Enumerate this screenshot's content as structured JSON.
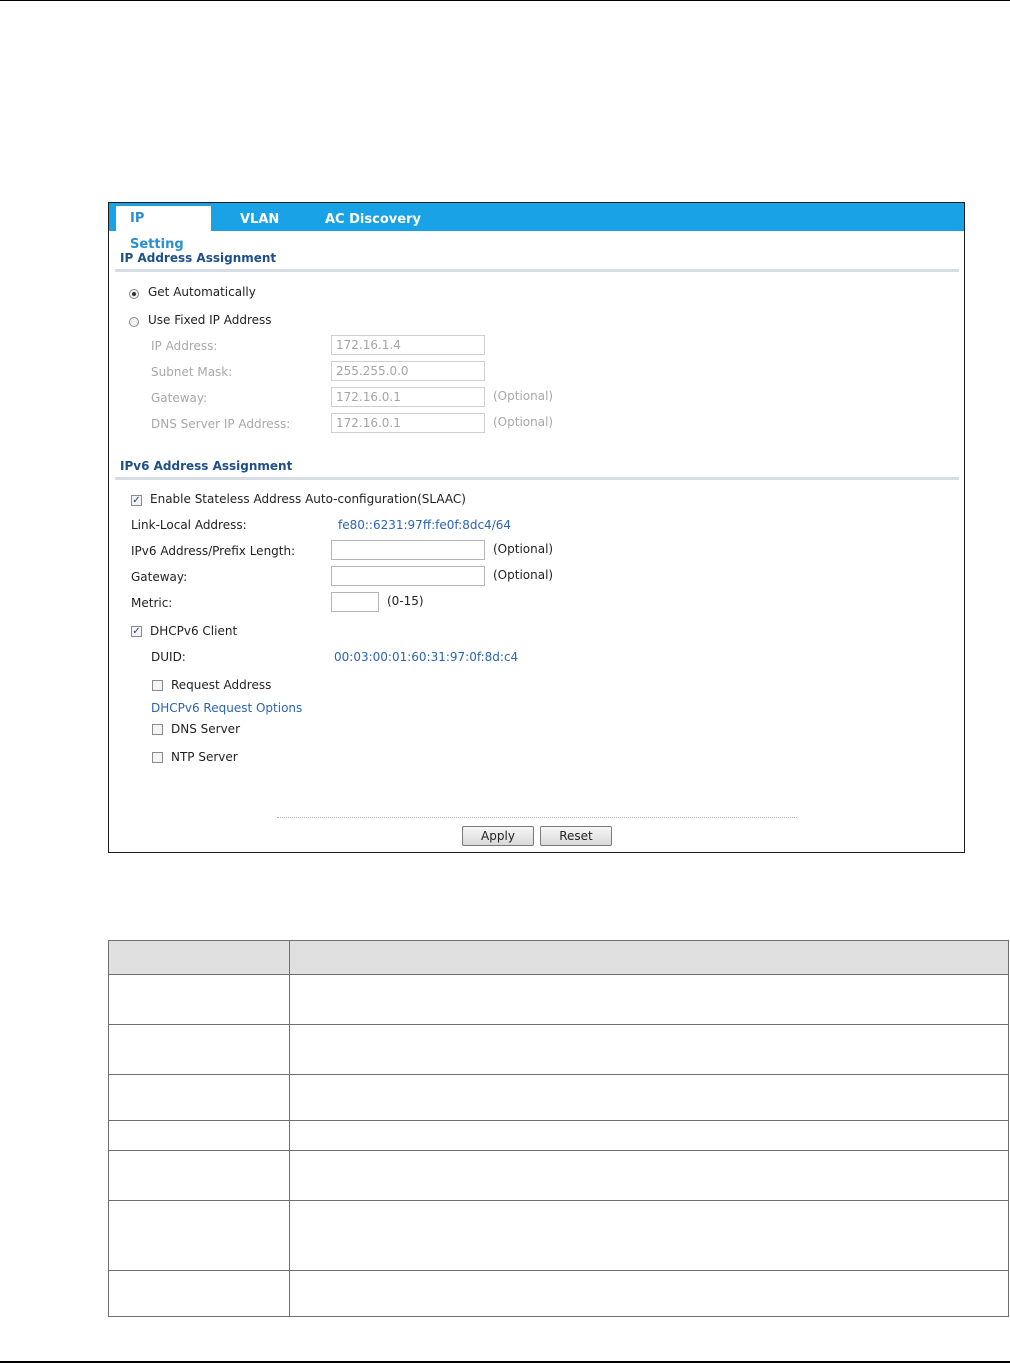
{
  "tabs": [
    {
      "label": "IP Setting",
      "active": true
    },
    {
      "label": "VLAN",
      "active": false
    },
    {
      "label": "AC Discovery",
      "active": false
    }
  ],
  "ipv4": {
    "title": "IP Address Assignment",
    "get_auto_label": "Get Automatically",
    "use_fixed_label": "Use Fixed IP Address",
    "mode": "Get Automatically",
    "ip_label": "IP Address:",
    "ip_value": "172.16.1.4",
    "mask_label": "Subnet Mask:",
    "mask_value": "255.255.0.0",
    "gateway_label": "Gateway:",
    "gateway_value": "172.16.0.1",
    "gateway_optional": "(Optional)",
    "dns_label": "DNS Server IP Address:",
    "dns_value": "172.16.0.1",
    "dns_optional": "(Optional)"
  },
  "ipv6": {
    "title": "IPv6 Address Assignment",
    "slaac_label": "Enable Stateless Address Auto-configuration(SLAAC)",
    "slaac_checked": true,
    "link_local_label": "Link-Local Address:",
    "link_local_value": "fe80::6231:97ff:fe0f:8dc4/64",
    "prefix_label": "IPv6 Address/Prefix Length:",
    "prefix_value": "",
    "prefix_optional": "(Optional)",
    "gateway_label": "Gateway:",
    "gateway_value": "",
    "gateway_optional": "(Optional)",
    "metric_label": "Metric:",
    "metric_value": "",
    "metric_range": "(0-15)",
    "dhcp_label": "DHCPv6 Client",
    "dhcp_checked": true,
    "duid_label": "DUID:",
    "duid_value": "00:03:00:01:60:31:97:0f:8d:c4",
    "request_address_label": "Request Address",
    "request_address_checked": false,
    "options_title": "DHCPv6 Request Options",
    "dns_server_label": "DNS Server",
    "dns_server_checked": false,
    "ntp_server_label": "NTP Server",
    "ntp_server_checked": false
  },
  "buttons": {
    "apply": "Apply",
    "reset": "Reset"
  },
  "colors": {
    "tab_bar": "#19a3e6",
    "section_title": "#1f4f8a",
    "link_value": "#2b64b5"
  }
}
